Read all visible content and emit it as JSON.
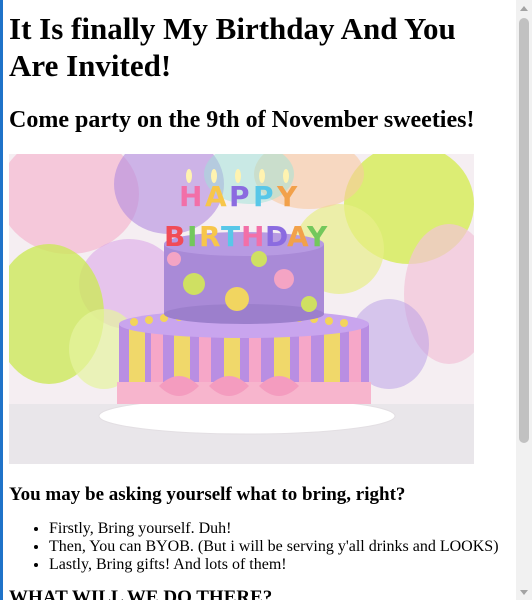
{
  "page": {
    "title": "It Is finally My Birthday And You Are Invited!",
    "subtitle": "Come party on the 9th of November sweeties!"
  },
  "hero_image": {
    "banner_text": "HAPPY BIRTHDAY",
    "banner_letters": [
      "H",
      "A",
      "P",
      "P",
      "Y",
      "B",
      "I",
      "R",
      "T",
      "H",
      "D",
      "A",
      "Y"
    ]
  },
  "bring_section": {
    "heading": "You may be asking yourself what to bring, right?",
    "items": [
      "Firstly, Bring yourself. Duh!",
      "Then, You can BYOB. (But i will be serving y'all drinks and LOOKS)",
      "Lastly, Bring gifts! And lots of them!"
    ]
  },
  "next_section": {
    "heading": "WHAT WILL WE DO THERE?"
  },
  "colors": {
    "accent_bar": "#1f73c9",
    "scroll_thumb": "#c1c1c1",
    "scroll_track": "#f1f1f1"
  }
}
